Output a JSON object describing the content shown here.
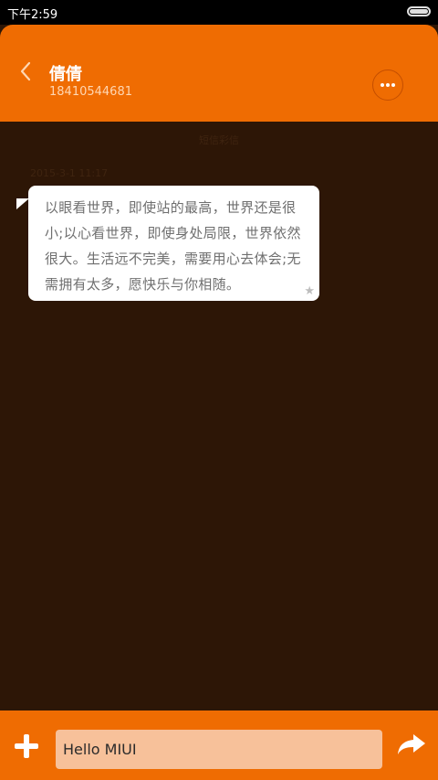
{
  "status_bar": {
    "time": "下午2:59",
    "battery_icon": "battery-icon"
  },
  "header": {
    "back_icon": "chevron-left-icon",
    "contact_name": "倩倩",
    "contact_number": "18410544681",
    "more_icon": "more-dots-icon"
  },
  "conversation": {
    "section_label": "短信彩信",
    "timestamp": "2015-3-1 11:17",
    "message": {
      "text": "以眼看世界，即使站的最高，世界还是很小;以心看世界，即使身处局限，世界依然很大。生活远不完美，需要用心去体会;无需拥有太多，愿快乐与你相随。",
      "star_icon": "star-icon"
    }
  },
  "composer": {
    "add_icon": "plus-icon",
    "input_value": "Hello MIUI",
    "send_icon": "send-arrow-icon"
  },
  "colors": {
    "accent": "#ef6c02",
    "background": "#2d1606",
    "bubble": "#ffffff",
    "input_bg": "#f7c19a"
  }
}
